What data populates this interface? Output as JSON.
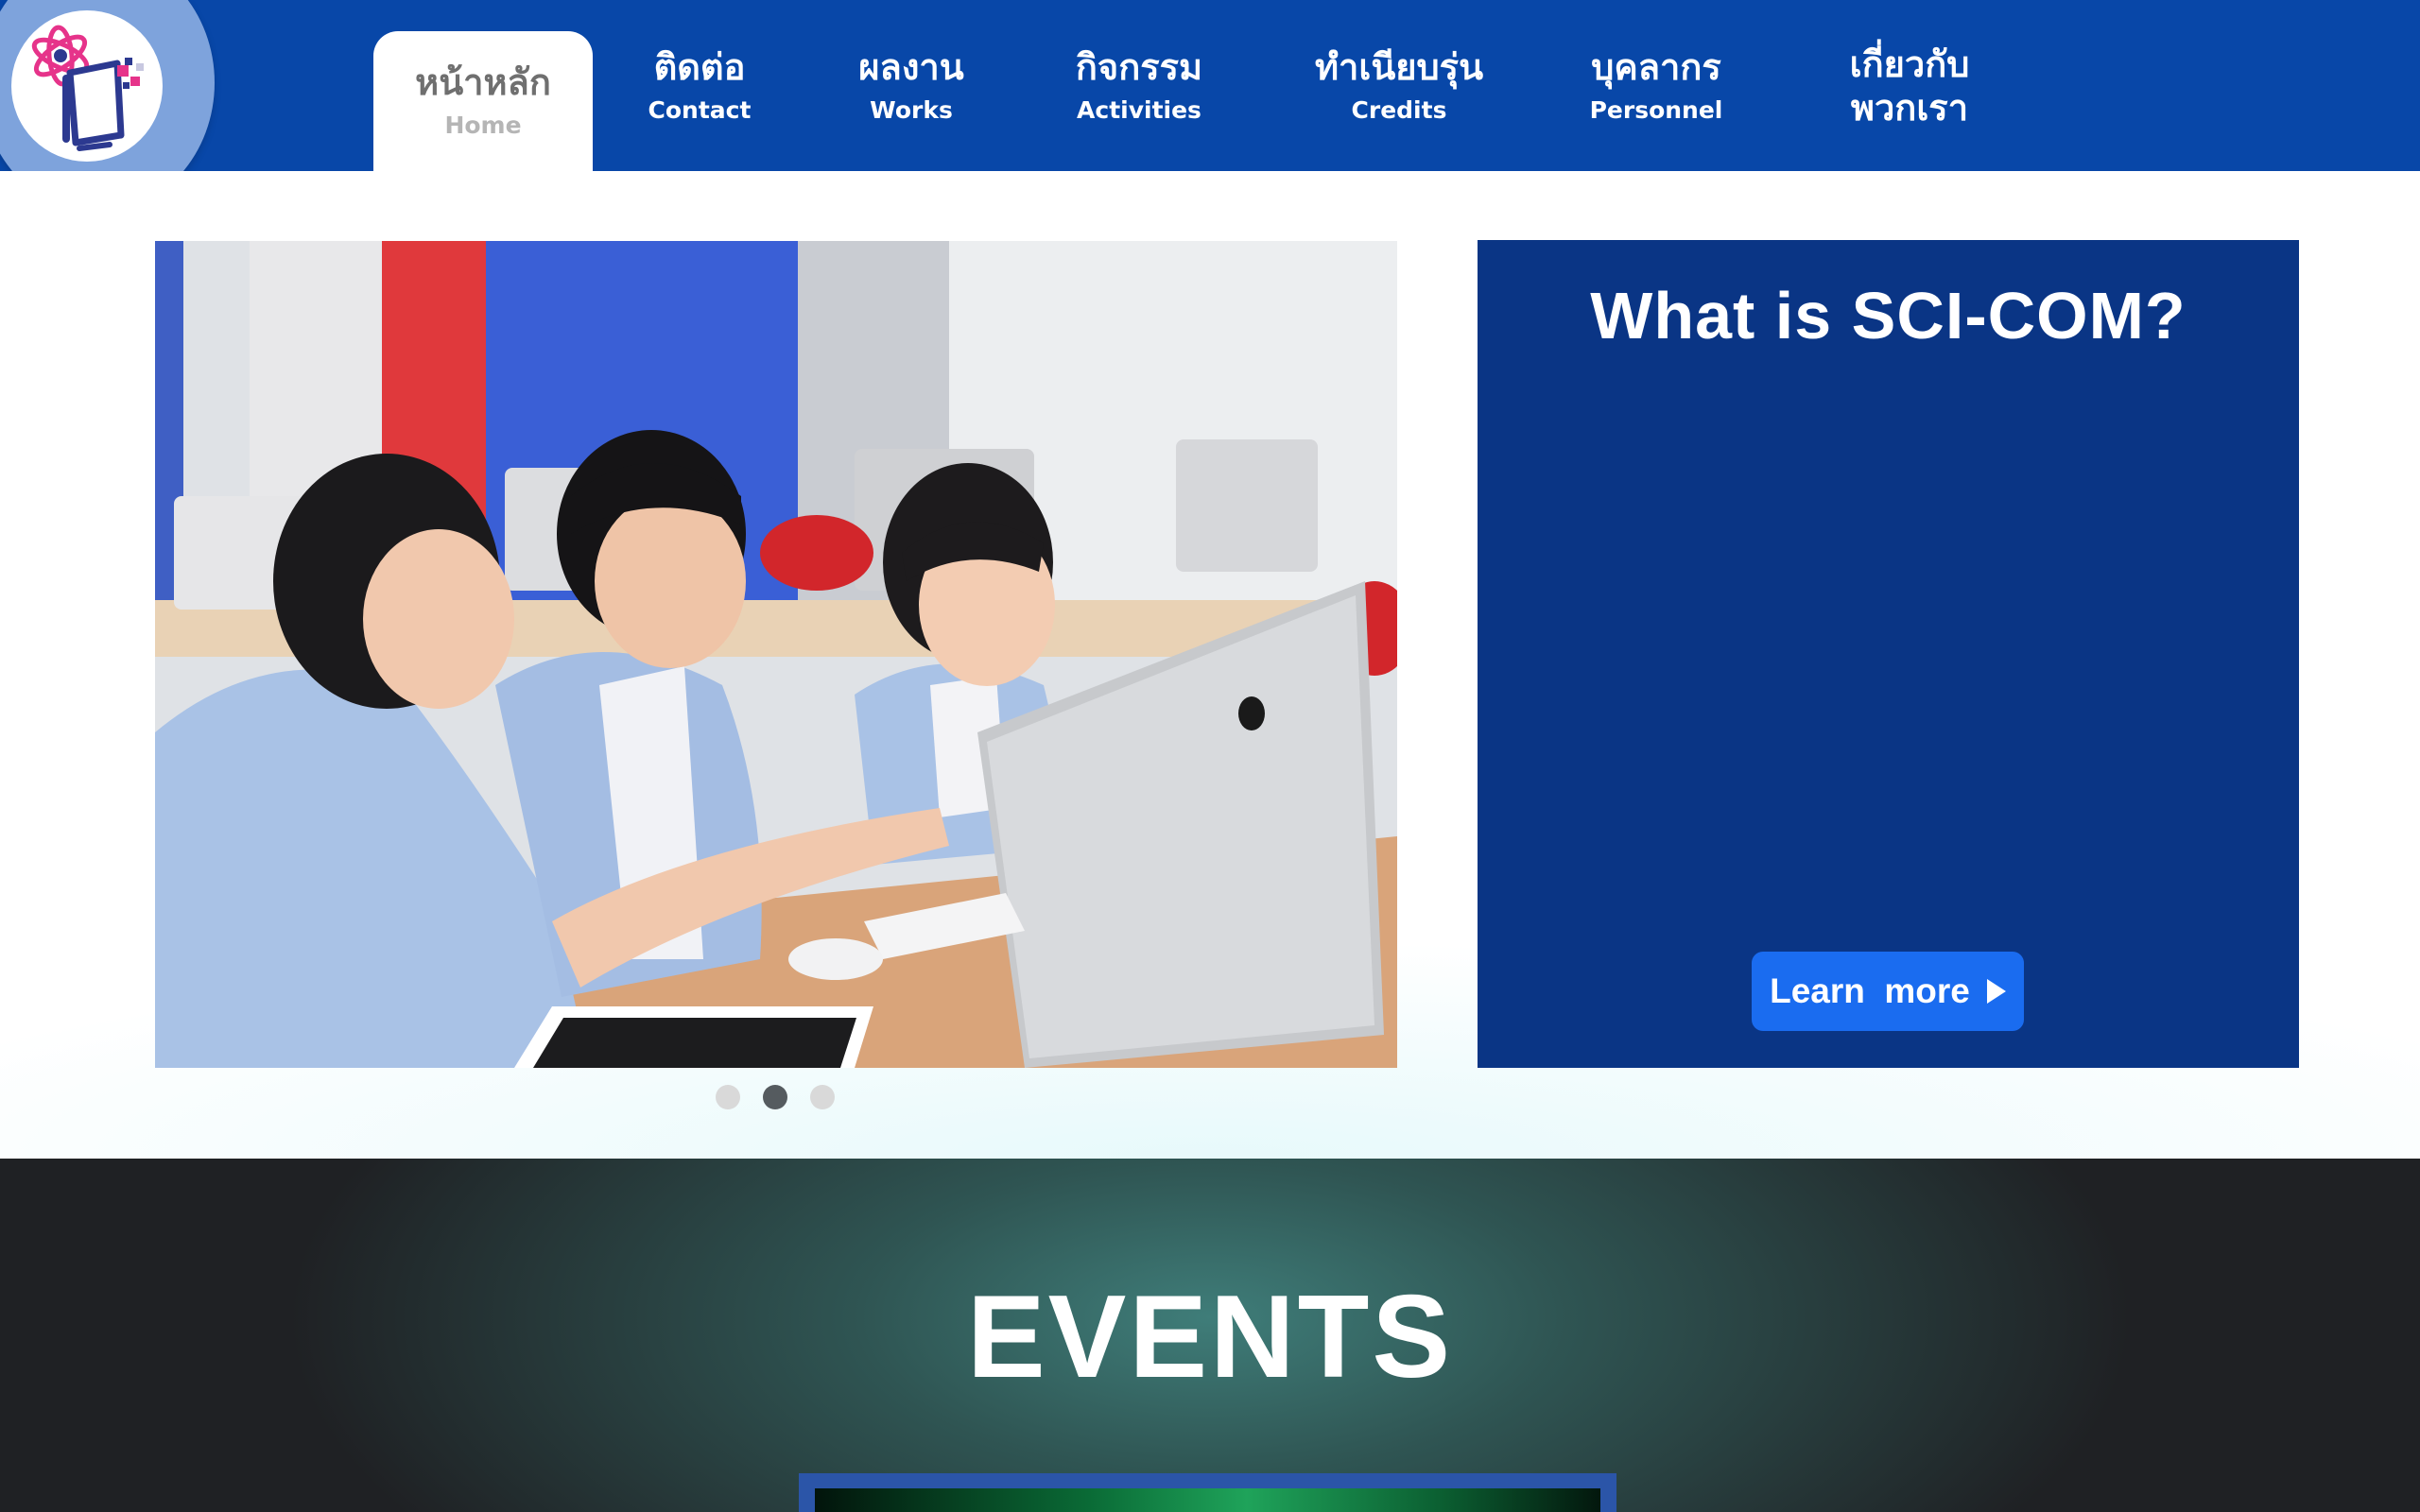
{
  "nav": {
    "logo_name": "SCI-COM logo",
    "items": [
      {
        "th": "หน้าหลัก",
        "en": "Home",
        "active": true
      },
      {
        "th": "ติดต่อ",
        "en": "Contact"
      },
      {
        "th": "ผลงาน",
        "en": "Works"
      },
      {
        "th": "กิจกรรม",
        "en": "Activities"
      },
      {
        "th": "ทำเนียบรุ่น",
        "en": "Credits"
      },
      {
        "th": "บุคลากร",
        "en": "Personnel"
      },
      {
        "th": "เกี่ยวกับ",
        "th2": "พวกเรา"
      }
    ]
  },
  "hero": {
    "photo_icon": "students-at-computers-photo",
    "carousel": {
      "count": 3,
      "active_index": 1
    },
    "panel": {
      "title": "What is SCI-COM?",
      "button_label": "Learn  more",
      "button_icon": "play-icon"
    }
  },
  "events": {
    "title": "EVENTS"
  },
  "colors": {
    "nav_bg": "#0847a8",
    "panel_bg": "#0a3585",
    "button_bg": "#1a6cf0",
    "events_bg": "#1f2124"
  }
}
